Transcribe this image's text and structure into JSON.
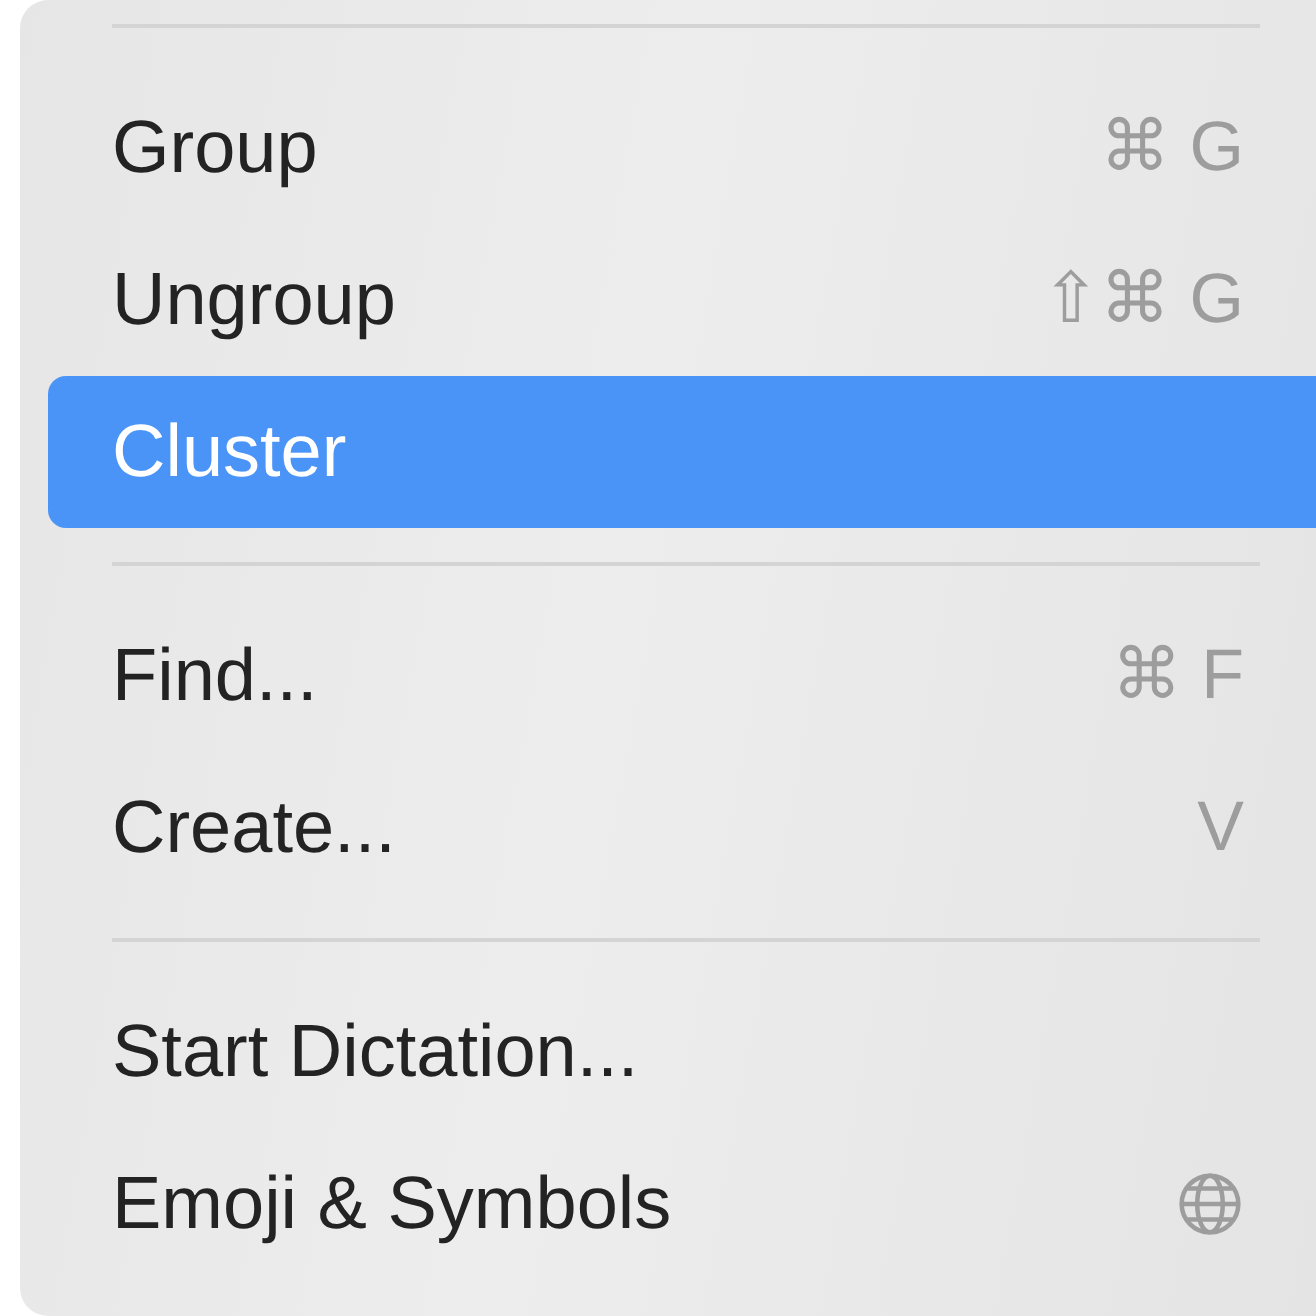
{
  "menu": {
    "items": [
      {
        "kind": "divider"
      },
      {
        "kind": "item",
        "label": "Group",
        "shortcut": "⌘ G",
        "selected": false
      },
      {
        "kind": "item",
        "label": "Ungroup",
        "shortcut": "⇧⌘ G",
        "selected": false
      },
      {
        "kind": "item",
        "label": "Cluster",
        "selected": true
      },
      {
        "kind": "divider"
      },
      {
        "kind": "item",
        "label": "Find...",
        "shortcut": "⌘ F",
        "selected": false
      },
      {
        "kind": "item",
        "label": "Create...",
        "shortcut": "V",
        "selected": false
      },
      {
        "kind": "divider"
      },
      {
        "kind": "item",
        "label": "Start Dictation...",
        "selected": false
      },
      {
        "kind": "iconitem",
        "label": "Emoji & Symbols",
        "selected": false
      }
    ]
  }
}
